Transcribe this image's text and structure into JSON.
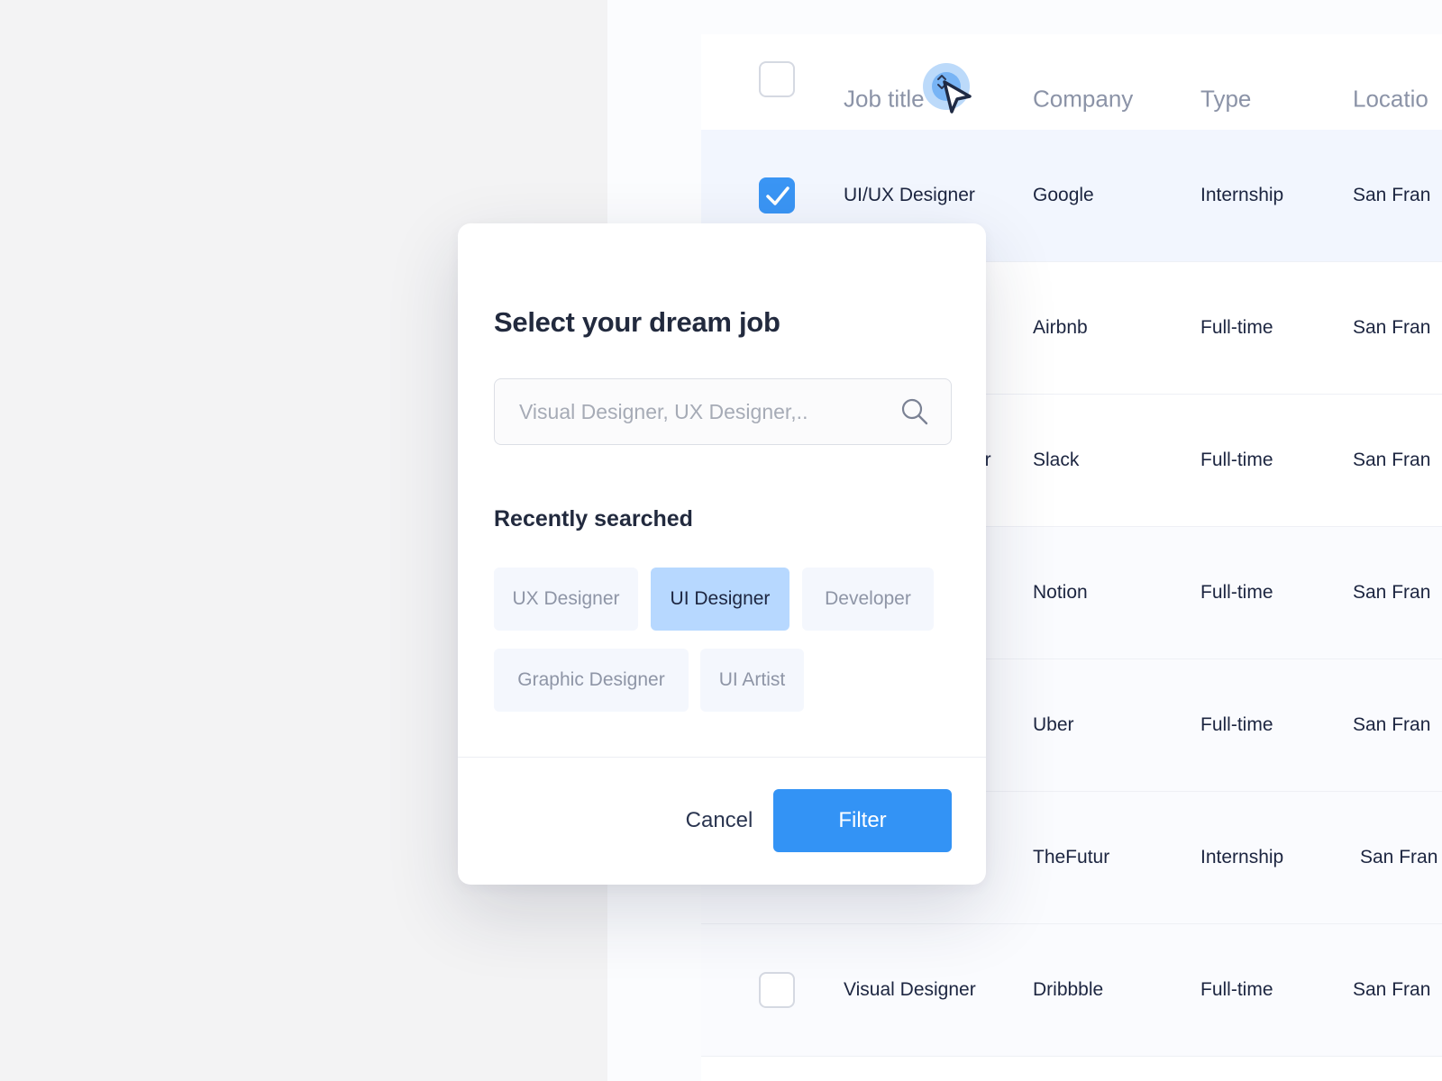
{
  "table": {
    "headers": [
      "Job title",
      "Company",
      "Type",
      "Locatio"
    ],
    "rows": [
      {
        "title": "UI/UX Designer",
        "company": "Google",
        "type": "Internship",
        "location": "San Fran",
        "checked": true
      },
      {
        "title": "",
        "company": "Airbnb",
        "type": "Full-time",
        "location": "San Fran",
        "checked": false
      },
      {
        "title": "er",
        "company": "Slack",
        "type": "Full-time",
        "location": "San Fran",
        "checked": false
      },
      {
        "title": "",
        "company": "Notion",
        "type": "Full-time",
        "location": "San Fran",
        "checked": false
      },
      {
        "title": "",
        "company": "Uber",
        "type": "Full-time",
        "location": "San Fran",
        "checked": false
      },
      {
        "title": "",
        "company": "TheFutur",
        "type": "Internship",
        "location": "San Fran",
        "checked": false
      },
      {
        "title": "Visual Designer",
        "company": "Dribbble",
        "type": "Full-time",
        "location": "San Fran",
        "checked": false
      }
    ]
  },
  "modal": {
    "title": "Select your dream job",
    "search": {
      "placeholder": "Visual Designer, UX Designer,..",
      "value": ""
    },
    "recent_title": "Recently searched",
    "chips": [
      "UX Designer",
      "UI Designer",
      "Developer",
      "Graphic Designer",
      "UI Artist"
    ],
    "active_chip": "UI Designer",
    "cancel_label": "Cancel",
    "filter_label": "Filter"
  },
  "colors": {
    "accent": "#3393f5",
    "chip_active": "#b7d8ff",
    "text_dark": "#1c2540",
    "text_muted": "#8b93a7"
  },
  "icons": {
    "search": "search-icon",
    "sort": "sort-arrows-icon",
    "cursor": "cursor-arrow-icon",
    "check": "check-icon"
  }
}
